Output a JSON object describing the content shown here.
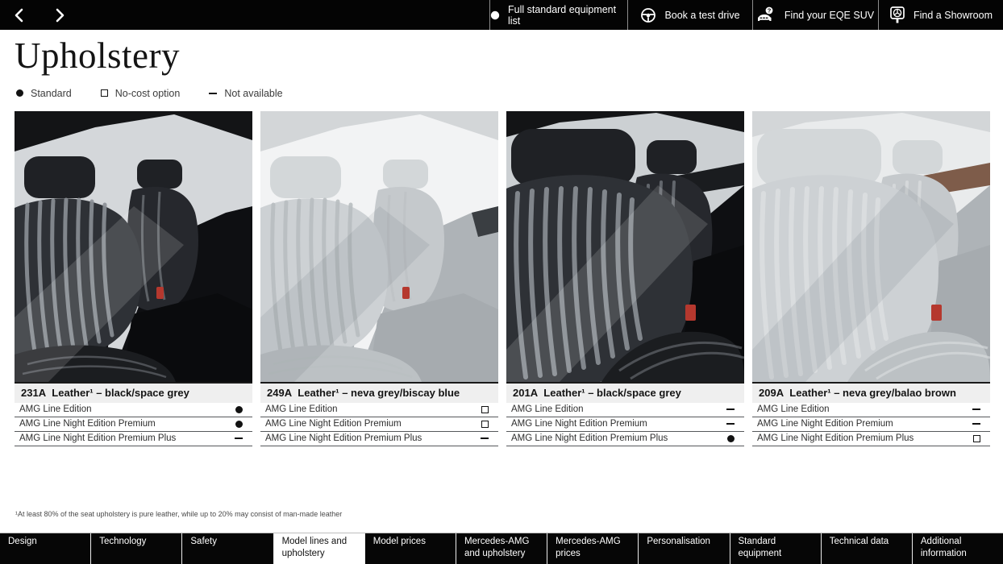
{
  "topbar": {
    "actions": [
      {
        "icon": "standard-dot-icon",
        "label": "Full standard equipment list"
      },
      {
        "icon": "steering-wheel-icon",
        "label": "Book a test drive"
      },
      {
        "icon": "car-question-icon",
        "label": "Find your EQE SUV"
      },
      {
        "icon": "showroom-pin-icon",
        "label": "Find a Showroom"
      }
    ]
  },
  "page": {
    "title": "Upholstery",
    "legend": [
      {
        "symbol": "standard",
        "label": "Standard"
      },
      {
        "symbol": "no-cost",
        "label": "No-cost option"
      },
      {
        "symbol": "not-available",
        "label": "Not available"
      }
    ],
    "footnote": "¹At least 80% of the seat upholstery is pure leather, while up to 20% may consist of man-made leather"
  },
  "upholstery": {
    "options": [
      {
        "title": "231A  Leather¹ – black/space grey",
        "variant": "dark-far",
        "rows": [
          {
            "label": "AMG Line Edition",
            "availability": "standard"
          },
          {
            "label": "AMG Line Night Edition Premium",
            "availability": "standard"
          },
          {
            "label": "AMG Line Night Edition Premium Plus",
            "availability": "not-available"
          }
        ]
      },
      {
        "title": "249A  Leather¹ – neva grey/biscay blue",
        "variant": "light-far",
        "rows": [
          {
            "label": "AMG Line Edition",
            "availability": "no-cost"
          },
          {
            "label": "AMG Line Night Edition Premium",
            "availability": "no-cost"
          },
          {
            "label": "AMG Line Night Edition Premium Plus",
            "availability": "not-available"
          }
        ]
      },
      {
        "title": "201A  Leather¹ – black/space grey",
        "variant": "dark-near",
        "rows": [
          {
            "label": "AMG Line Edition",
            "availability": "not-available"
          },
          {
            "label": "AMG Line Night Edition Premium",
            "availability": "not-available"
          },
          {
            "label": "AMG Line Night Edition Premium Plus",
            "availability": "standard"
          }
        ]
      },
      {
        "title": "209A  Leather¹ – neva grey/balao brown",
        "variant": "light-near",
        "rows": [
          {
            "label": "AMG Line Edition",
            "availability": "not-available"
          },
          {
            "label": "AMG Line Night Edition Premium",
            "availability": "not-available"
          },
          {
            "label": "AMG Line Night Edition Premium Plus",
            "availability": "no-cost"
          }
        ]
      }
    ]
  },
  "bottomnav": {
    "items": [
      {
        "label": "Design",
        "active": false
      },
      {
        "label": "Technology",
        "active": false
      },
      {
        "label": "Safety",
        "active": false
      },
      {
        "label": "Model lines and upholstery",
        "active": true
      },
      {
        "label": "Model prices",
        "active": false
      },
      {
        "label": "Mercedes-AMG and upholstery",
        "active": false
      },
      {
        "label": "Mercedes-AMG prices",
        "active": false
      },
      {
        "label": "Personalisation",
        "active": false
      },
      {
        "label": "Standard equipment",
        "active": false
      },
      {
        "label": "Technical data",
        "active": false
      },
      {
        "label": "Additional information",
        "active": false
      }
    ]
  },
  "colors": {
    "bar_background": "#040404",
    "page_background": "#ffffff",
    "active_tab_background": "#ffffff",
    "table_header_background": "#efefef",
    "symbol_color": "#121212",
    "seatbelt_buckle_red": "#b5382e"
  }
}
